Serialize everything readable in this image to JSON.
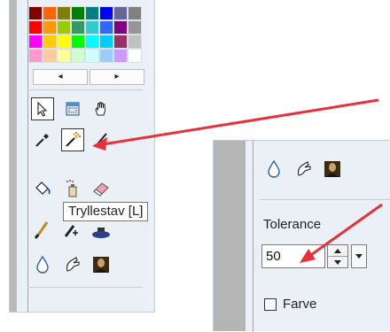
{
  "palette": {
    "colors": [
      "#800000",
      "#ff6600",
      "#808000",
      "#008000",
      "#008080",
      "#0000ff",
      "#666699",
      "#808080",
      "#ff0000",
      "#ff9900",
      "#99cc00",
      "#339966",
      "#33cccc",
      "#3366ff",
      "#800080",
      "#969696",
      "#ff00ff",
      "#ffcc00",
      "#ffff00",
      "#00ff00",
      "#00ffff",
      "#00ccff",
      "#993366",
      "#c0c0c0",
      "#ff99cc",
      "#ffcc99",
      "#ffff99",
      "#ccffcc",
      "#ccffff",
      "#99ccff",
      "#cc99ff",
      "#ffffff"
    ]
  },
  "nav": {
    "prev_glyph": "◂",
    "next_glyph": "▸"
  },
  "tools": [
    "arrow-icon",
    "selection-icon",
    "hand-icon",
    "eyedropper-icon",
    "magic-wand-icon",
    "line-icon",
    "fill-bucket-icon",
    "spray-icon",
    "eraser-icon",
    "brush-icon",
    "pencil-icon",
    "stamp-icon",
    "drop-icon",
    "smudge-icon",
    "mona-lisa-icon"
  ],
  "tooltip": {
    "text": "Tryllestav [L]"
  },
  "tolerance": {
    "label": "Tolerance",
    "value": "50"
  },
  "farve": {
    "label": "Farve",
    "checked": false
  },
  "colors": {
    "arrow": "#e8303a",
    "panel": "#eaf0f6",
    "selected_border": "#333333"
  }
}
